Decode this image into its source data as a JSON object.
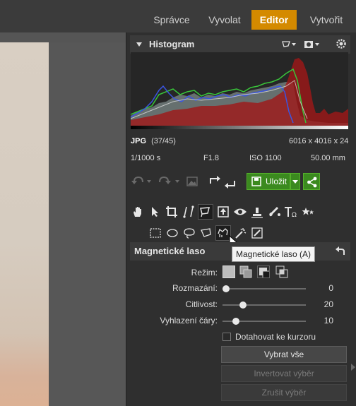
{
  "nav": {
    "tabs": [
      {
        "label": "Správce"
      },
      {
        "label": "Vyvolat"
      },
      {
        "label": "Editor"
      },
      {
        "label": "Vytvořit"
      }
    ],
    "active_index": 2,
    "accent_color": "#d48a00"
  },
  "histogram": {
    "title": "Histogram",
    "format": "JPG",
    "index": "(37/45)",
    "dimensions": "6016 x 4016 x 24",
    "shutter": "1/1000 s",
    "aperture": "F1.8",
    "iso": "ISO 1100",
    "focal": "50.00 mm"
  },
  "toolbar": {
    "save_label": "Uložit",
    "save_color": "#3b8a1f"
  },
  "tools": {
    "tooltip": "Magnetické laso (A)"
  },
  "lasso_panel": {
    "title": "Magnetické laso",
    "mode_label": "Režim:",
    "params": [
      {
        "label": "Rozmazání:",
        "value": "0",
        "fraction": 0.0
      },
      {
        "label": "Citlivost:",
        "value": "20",
        "fraction": 0.22
      },
      {
        "label": "Vyhlazení čáry:",
        "value": "10",
        "fraction": 0.13
      }
    ],
    "snap_label": "Dotahovat ke kurzoru",
    "select_all": "Vybrat vše",
    "invert": "Invertovat výběr",
    "deselect": "Zrušit výběr"
  }
}
